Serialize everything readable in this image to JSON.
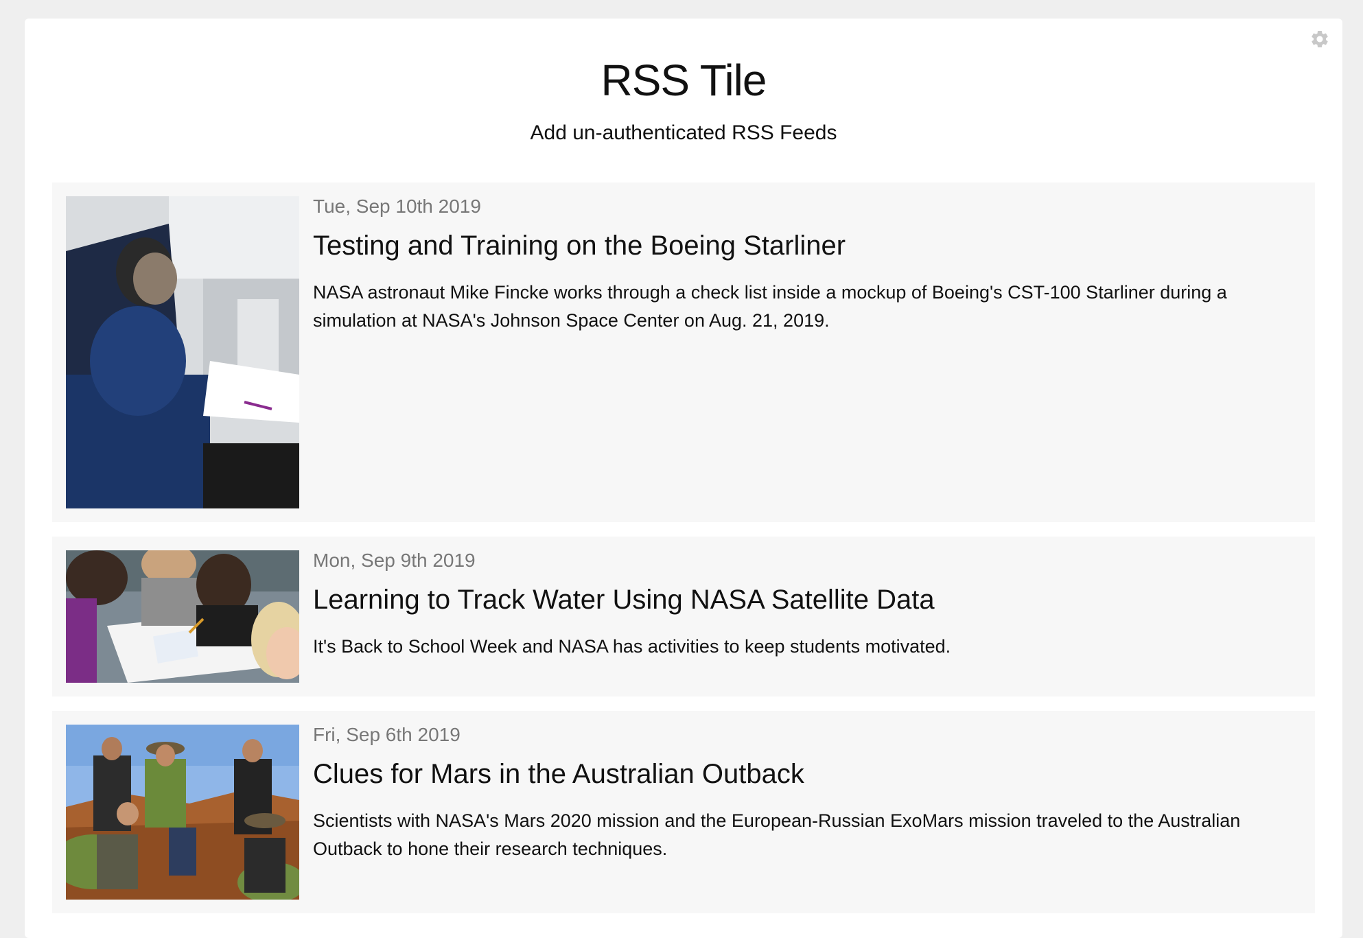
{
  "tile": {
    "title": "RSS Tile",
    "subtitle": "Add un-authenticated RSS Feeds",
    "settings_icon": "gear-icon"
  },
  "feed": {
    "items": [
      {
        "date": "Tue, Sep 10th 2019",
        "title": "Testing and Training on the Boeing Starliner",
        "summary": "NASA astronaut Mike Fincke works through a check list inside a mockup of Boeing's CST-100 Starliner during a simulation at NASA's Johnson Space Center on Aug. 21, 2019."
      },
      {
        "date": "Mon, Sep 9th 2019",
        "title": "Learning to Track Water Using NASA Satellite Data",
        "summary": "It's Back to School Week and NASA has activities to keep students motivated."
      },
      {
        "date": "Fri, Sep 6th 2019",
        "title": "Clues for Mars in the Australian Outback",
        "summary": "Scientists with NASA's Mars 2020 mission and the European-Russian ExoMars mission traveled to the Australian Outback to hone their research techniques."
      }
    ]
  },
  "colors": {
    "page_background": "#efefef",
    "tile_background": "#ffffff",
    "item_background": "#f7f7f7",
    "date_text": "#777777",
    "body_text": "#111111",
    "gear_icon": "#c8c8c8"
  }
}
